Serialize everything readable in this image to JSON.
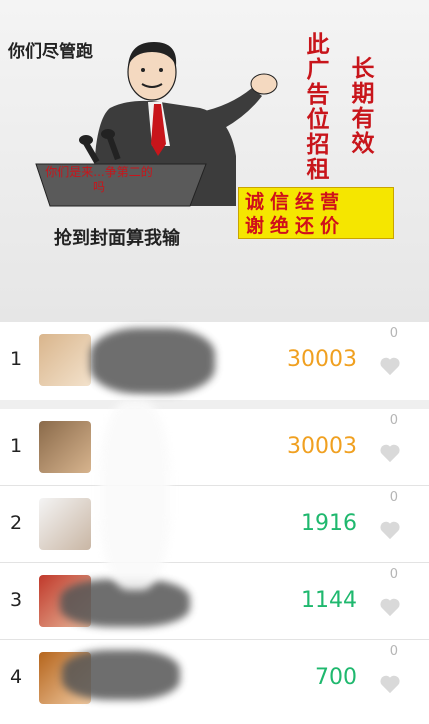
{
  "banner": {
    "top_caption": "你们尽管跑",
    "ad_text_1": "此广告位招租",
    "ad_text_2": "长期有效",
    "podium_text": "你们是来...争第二的吗",
    "bottom_caption": "抢到封面算我输",
    "slogan_line_1": "诚信经营",
    "slogan_line_2": "谢绝还价"
  },
  "colors": {
    "gold_score": "#f0a020",
    "green_score": "#1fb86e",
    "ad_red": "#c8151b",
    "slogan_yellow": "#f5e600"
  },
  "pinned": {
    "rank": "1",
    "score": "30003",
    "likes": "0",
    "icon": "heart-icon"
  },
  "rows": [
    {
      "rank": "1",
      "score": "30003",
      "likes": "0",
      "icon": "heart-icon"
    },
    {
      "rank": "2",
      "score": "1916",
      "likes": "0",
      "icon": "heart-icon"
    },
    {
      "rank": "3",
      "score": "1144",
      "likes": "0",
      "icon": "heart-icon"
    },
    {
      "rank": "4",
      "score": "700",
      "likes": "0",
      "icon": "heart-icon"
    }
  ]
}
